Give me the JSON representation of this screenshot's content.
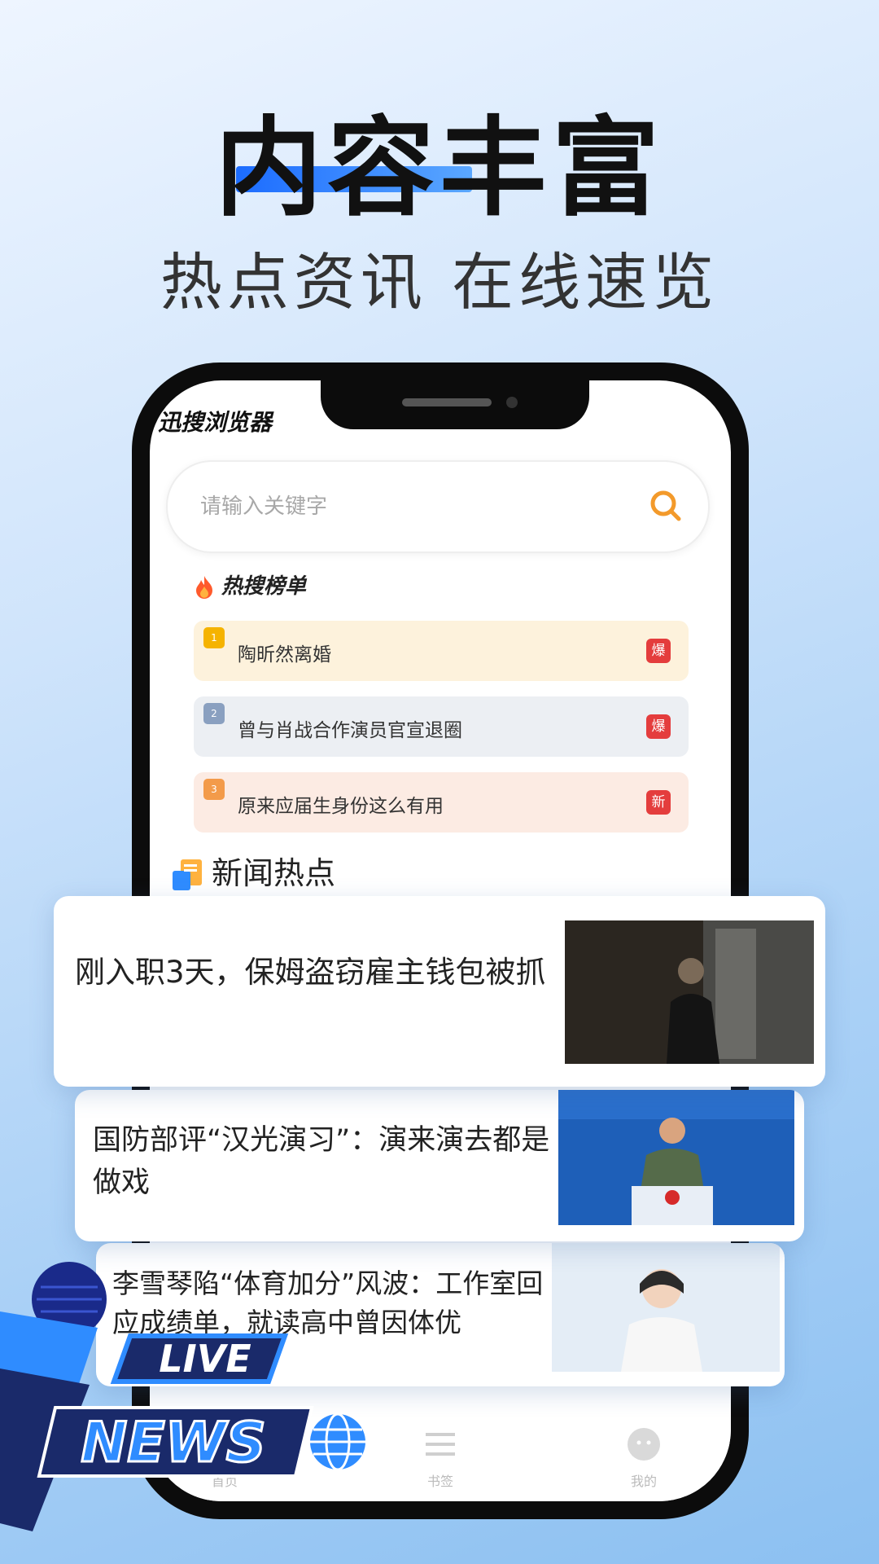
{
  "promo": {
    "headline": "内容丰富",
    "subheadline": "热点资讯 在线速览"
  },
  "app": {
    "name": "迅搜浏览器",
    "search": {
      "placeholder": "请输入关键字"
    },
    "hot_list": {
      "title": "热搜榜单",
      "items": [
        {
          "rank": "1",
          "text": "陶昕然离婚",
          "tag": "爆",
          "rank_color": "#f5b300",
          "bg": "#fdf2dc"
        },
        {
          "rank": "2",
          "text": "曾与肖战合作演员官宣退圈",
          "tag": "爆",
          "rank_color": "#8aa0c0",
          "bg": "#eceff3"
        },
        {
          "rank": "3",
          "text": "原来应届生身份这么有用",
          "tag": "新",
          "rank_color": "#f39b4a",
          "bg": "#fcebe3"
        }
      ]
    },
    "news_section": {
      "title": "新闻热点"
    },
    "news": [
      {
        "title": "刚入职3天，保姆盗窃雇主钱包被抓"
      },
      {
        "title": "国防部评“汉光演习”：演来演去都是做戏"
      },
      {
        "title": "李雪琴陷“体育加分”风波：工作室回应成绩单，就读高中曾因体优"
      }
    ],
    "tab_bar": {
      "tabs": [
        "首页",
        "书签",
        "我的"
      ]
    }
  },
  "overlay": {
    "line1": "LIVE",
    "line2": "NEWS"
  },
  "colors": {
    "accent": "#1c6cff",
    "search_icon": "#f39a2b",
    "hot_tag": "#e43d3d"
  }
}
